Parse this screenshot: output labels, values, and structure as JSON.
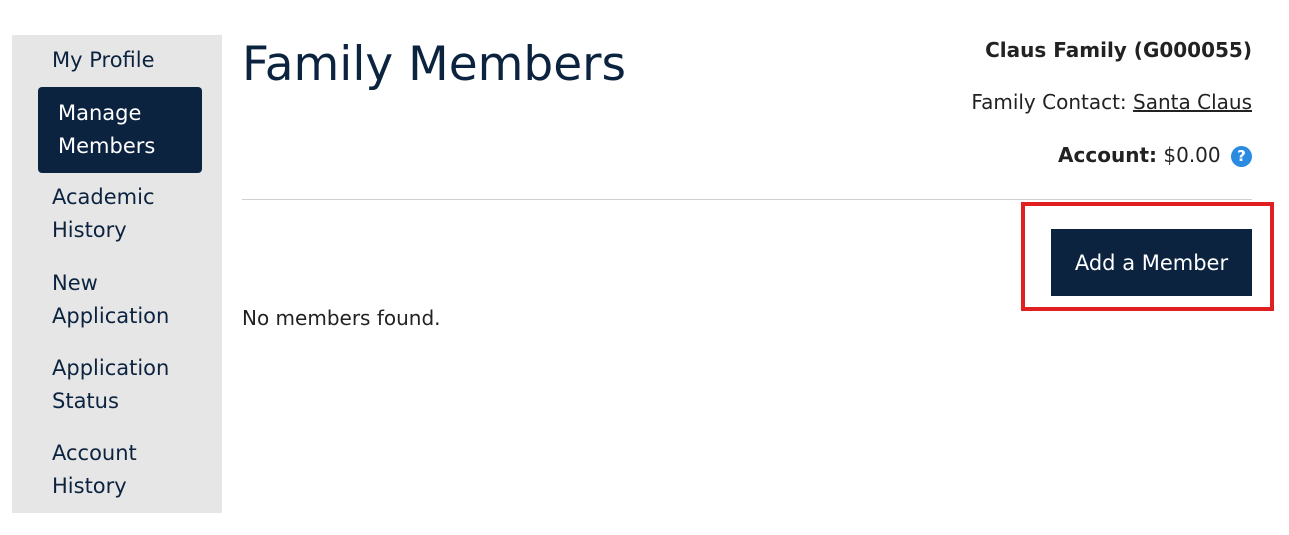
{
  "sidebar": {
    "items": [
      {
        "label": "My Profile",
        "active": false
      },
      {
        "label": "Manage Members",
        "active": true
      },
      {
        "label": "Academic History",
        "active": false
      },
      {
        "label": "New Application",
        "active": false
      },
      {
        "label": "Application Status",
        "active": false
      },
      {
        "label": "Account History",
        "active": false
      }
    ]
  },
  "header": {
    "title": "Family Members",
    "family_name": "Claus Family (G000055)",
    "contact_label": "Family Contact:",
    "contact_name": "Santa Claus",
    "account_label": "Account:",
    "account_value": "$0.00",
    "help_icon": "question-circle-icon"
  },
  "main": {
    "add_button_label": "Add a Member",
    "empty_message": "No members found."
  },
  "colors": {
    "navy": "#0c2340",
    "sidebar_bg": "#e6e6e6",
    "help_blue": "#2a8be0",
    "highlight_red": "#e02020"
  }
}
